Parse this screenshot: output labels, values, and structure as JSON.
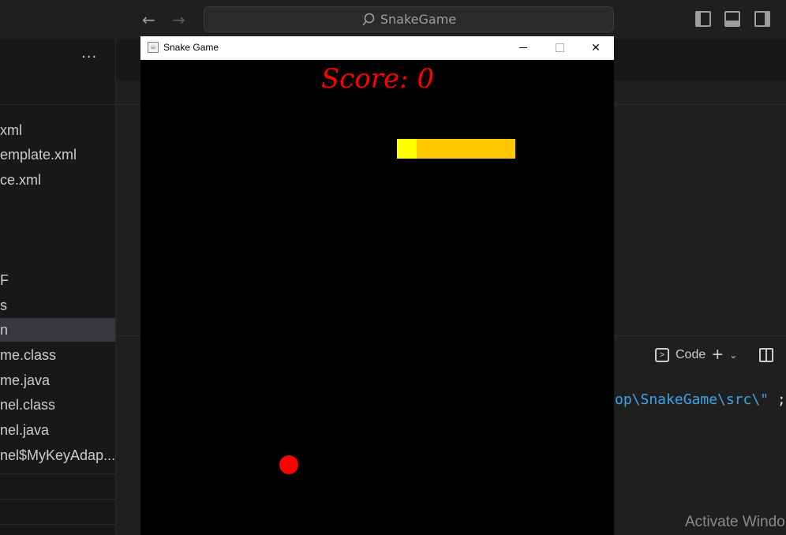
{
  "vscode": {
    "search_text": "SnakeGame",
    "more_label": "···",
    "files": [
      {
        "label": "xml"
      },
      {
        "label": "emplate.xml"
      },
      {
        "label": "ce.xml"
      },
      {
        "label": "F"
      },
      {
        "label": "s"
      },
      {
        "label": "n"
      },
      {
        "label": "me.class"
      },
      {
        "label": "me.java"
      },
      {
        "label": "nel.class"
      },
      {
        "label": "nel.java"
      },
      {
        "label": "nel$MyKeyAdap..."
      }
    ],
    "terminal": {
      "profile_label": "Code",
      "path_text": "op\\SnakeGame\\src\\\"",
      "path_suffix": ";"
    },
    "watermark": "Activate Windo"
  },
  "java_window": {
    "title": "Snake Game",
    "close_glyph": "✕",
    "game": {
      "score_text": "Score: 0",
      "score_value": 0,
      "colors": {
        "background": "#000000",
        "snake_head": "#ffff00",
        "snake_body": "#ffc800",
        "apple": "#ff0000",
        "score": "#ff0000"
      },
      "snake_length": 6
    }
  }
}
